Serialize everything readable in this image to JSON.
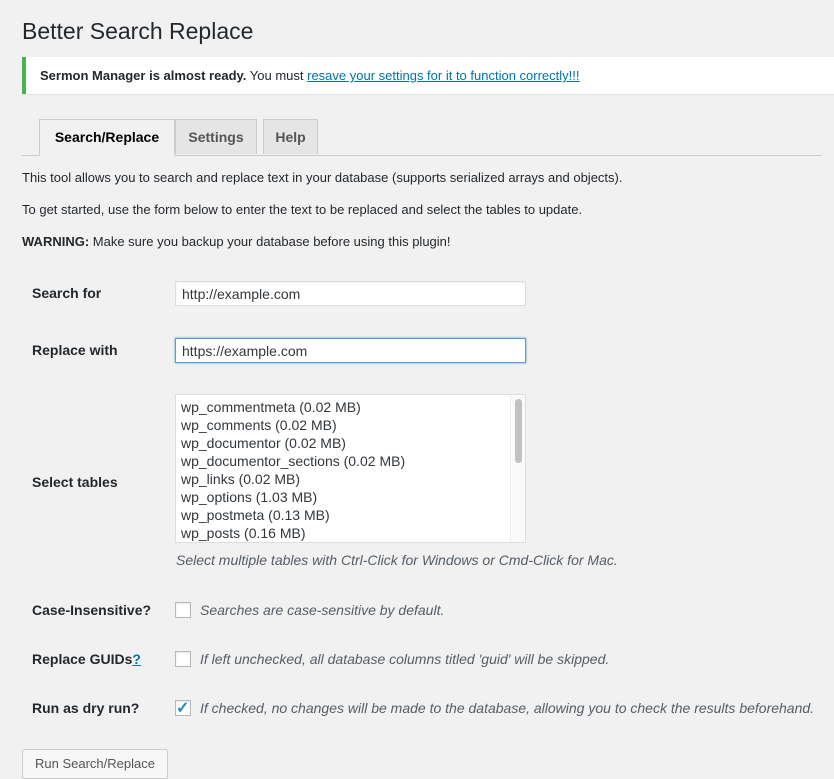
{
  "page": {
    "title": "Better Search Replace"
  },
  "notice": {
    "bold_text": "Sermon Manager is almost ready.",
    "text": " You must ",
    "link_text": "resave your settings for it to function correctly!!!"
  },
  "tabs": [
    {
      "label": "Search/Replace",
      "active": true
    },
    {
      "label": "Settings",
      "active": false
    },
    {
      "label": "Help",
      "active": false
    }
  ],
  "intro": {
    "line1": "This tool allows you to search and replace text in your database (supports serialized arrays and objects).",
    "line2": "To get started, use the form below to enter the text to be replaced and select the tables to update.",
    "warning_label": "WARNING:",
    "warning_text": " Make sure you backup your database before using this plugin!"
  },
  "form": {
    "search_label": "Search for",
    "search_value": "http://example.com",
    "replace_label": "Replace with",
    "replace_value": "https://example.com",
    "tables_label": "Select tables",
    "tables": [
      "wp_commentmeta (0.02 MB)",
      "wp_comments (0.02 MB)",
      "wp_documentor (0.02 MB)",
      "wp_documentor_sections (0.02 MB)",
      "wp_links (0.02 MB)",
      "wp_options (1.03 MB)",
      "wp_postmeta (0.13 MB)",
      "wp_posts (0.16 MB)"
    ],
    "tables_hint": "Select multiple tables with Ctrl-Click for Windows or Cmd-Click for Mac.",
    "case_label": "Case-Insensitive?",
    "case_desc": "Searches are case-sensitive by default.",
    "case_checked": false,
    "guids_label": "Replace GUIDs",
    "guids_help": "?",
    "guids_desc": "If left unchecked, all database columns titled 'guid' will be skipped.",
    "guids_checked": false,
    "dry_label": "Run as dry run?",
    "dry_desc": "If checked, no changes will be made to the database, allowing you to check the results beforehand.",
    "dry_checked": true,
    "check_mark": "✓",
    "submit_label": "Run Search/Replace"
  },
  "colors": {
    "notice_border": "#46b450",
    "link": "#0073aa",
    "checkbox_check": "#1e8cbe"
  }
}
